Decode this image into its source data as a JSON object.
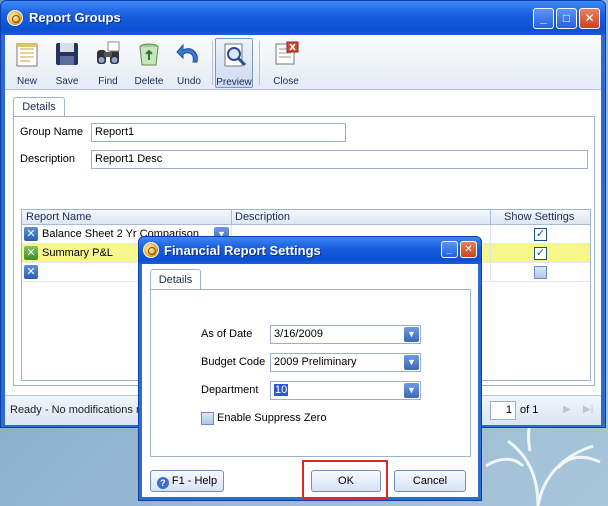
{
  "window": {
    "title": "Report Groups"
  },
  "toolbar": {
    "new": "New",
    "save": "Save",
    "find": "Find",
    "delete": "Delete",
    "undo": "Undo",
    "preview": "Preview",
    "close": "Close"
  },
  "tabs": {
    "details": "Details"
  },
  "form": {
    "group_name_label": "Group Name",
    "group_name_value": "Report1",
    "description_label": "Description",
    "description_value": "Report1 Desc"
  },
  "grid": {
    "columns": [
      "Report Name",
      "Description",
      "Show Settings"
    ],
    "rows": [
      {
        "name": "Balance Sheet 2 Yr Comparison",
        "description": "",
        "show_settings": true
      },
      {
        "name": "Summary P&L",
        "description": "",
        "show_settings": true
      },
      {
        "name": "",
        "description": "",
        "show_settings": false
      }
    ]
  },
  "status": {
    "text": "Ready - No modifications m",
    "page": "1",
    "of": "of",
    "total": "1"
  },
  "dialog": {
    "title": "Financial Report Settings",
    "tab": "Details",
    "as_of_date_label": "As of Date",
    "as_of_date_value": "3/16/2009",
    "budget_code_label": "Budget Code",
    "budget_code_value": "2009 Preliminary",
    "department_label": "Department",
    "department_value": "10",
    "suppress_zero_label": "Enable Suppress Zero",
    "help": "F1 - Help",
    "ok": "OK",
    "cancel": "Cancel"
  },
  "colors": {
    "accent": "#0b4fd4",
    "highlight_row": "#f6f68c",
    "ok_outline": "#d8282a"
  }
}
